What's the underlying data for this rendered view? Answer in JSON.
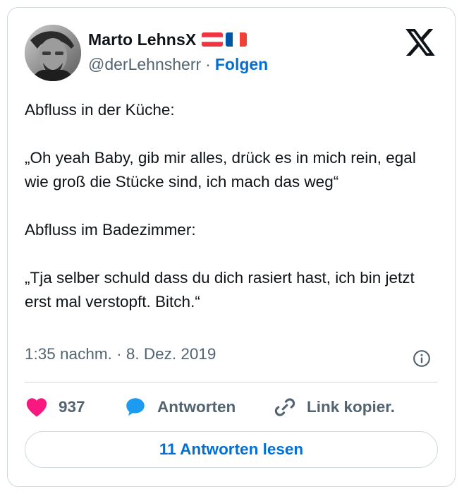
{
  "author": {
    "name": "Marto LehnsX",
    "handle": "@derLehnsherr",
    "separator": "·",
    "follow_label": "Folgen",
    "flags": [
      "flag-austria-icon",
      "flag-france-icon"
    ]
  },
  "tweet": {
    "text": "Abfluss in der Küche:\n\n„Oh yeah Baby, gib mir alles, drück es in mich rein, egal wie groß die Stücke sind, ich mach das weg“\n\nAbfluss im Badezimmer:\n\n„Tja selber schuld dass du dich rasiert hast, ich bin jetzt erst mal verstopft. Bitch.“",
    "timestamp": "1:35 nachm. · 8. Dez. 2019"
  },
  "actions": {
    "like_count": "937",
    "reply_label": "Antworten",
    "copy_link_label": "Link kopier."
  },
  "footer": {
    "read_replies_label": "11 Antworten lesen"
  },
  "colors": {
    "link_blue": "#006fd6",
    "like_pink": "#f91880",
    "reply_blue": "#1d9bf0",
    "muted_gray": "#536471",
    "border": "#cfd9de"
  }
}
